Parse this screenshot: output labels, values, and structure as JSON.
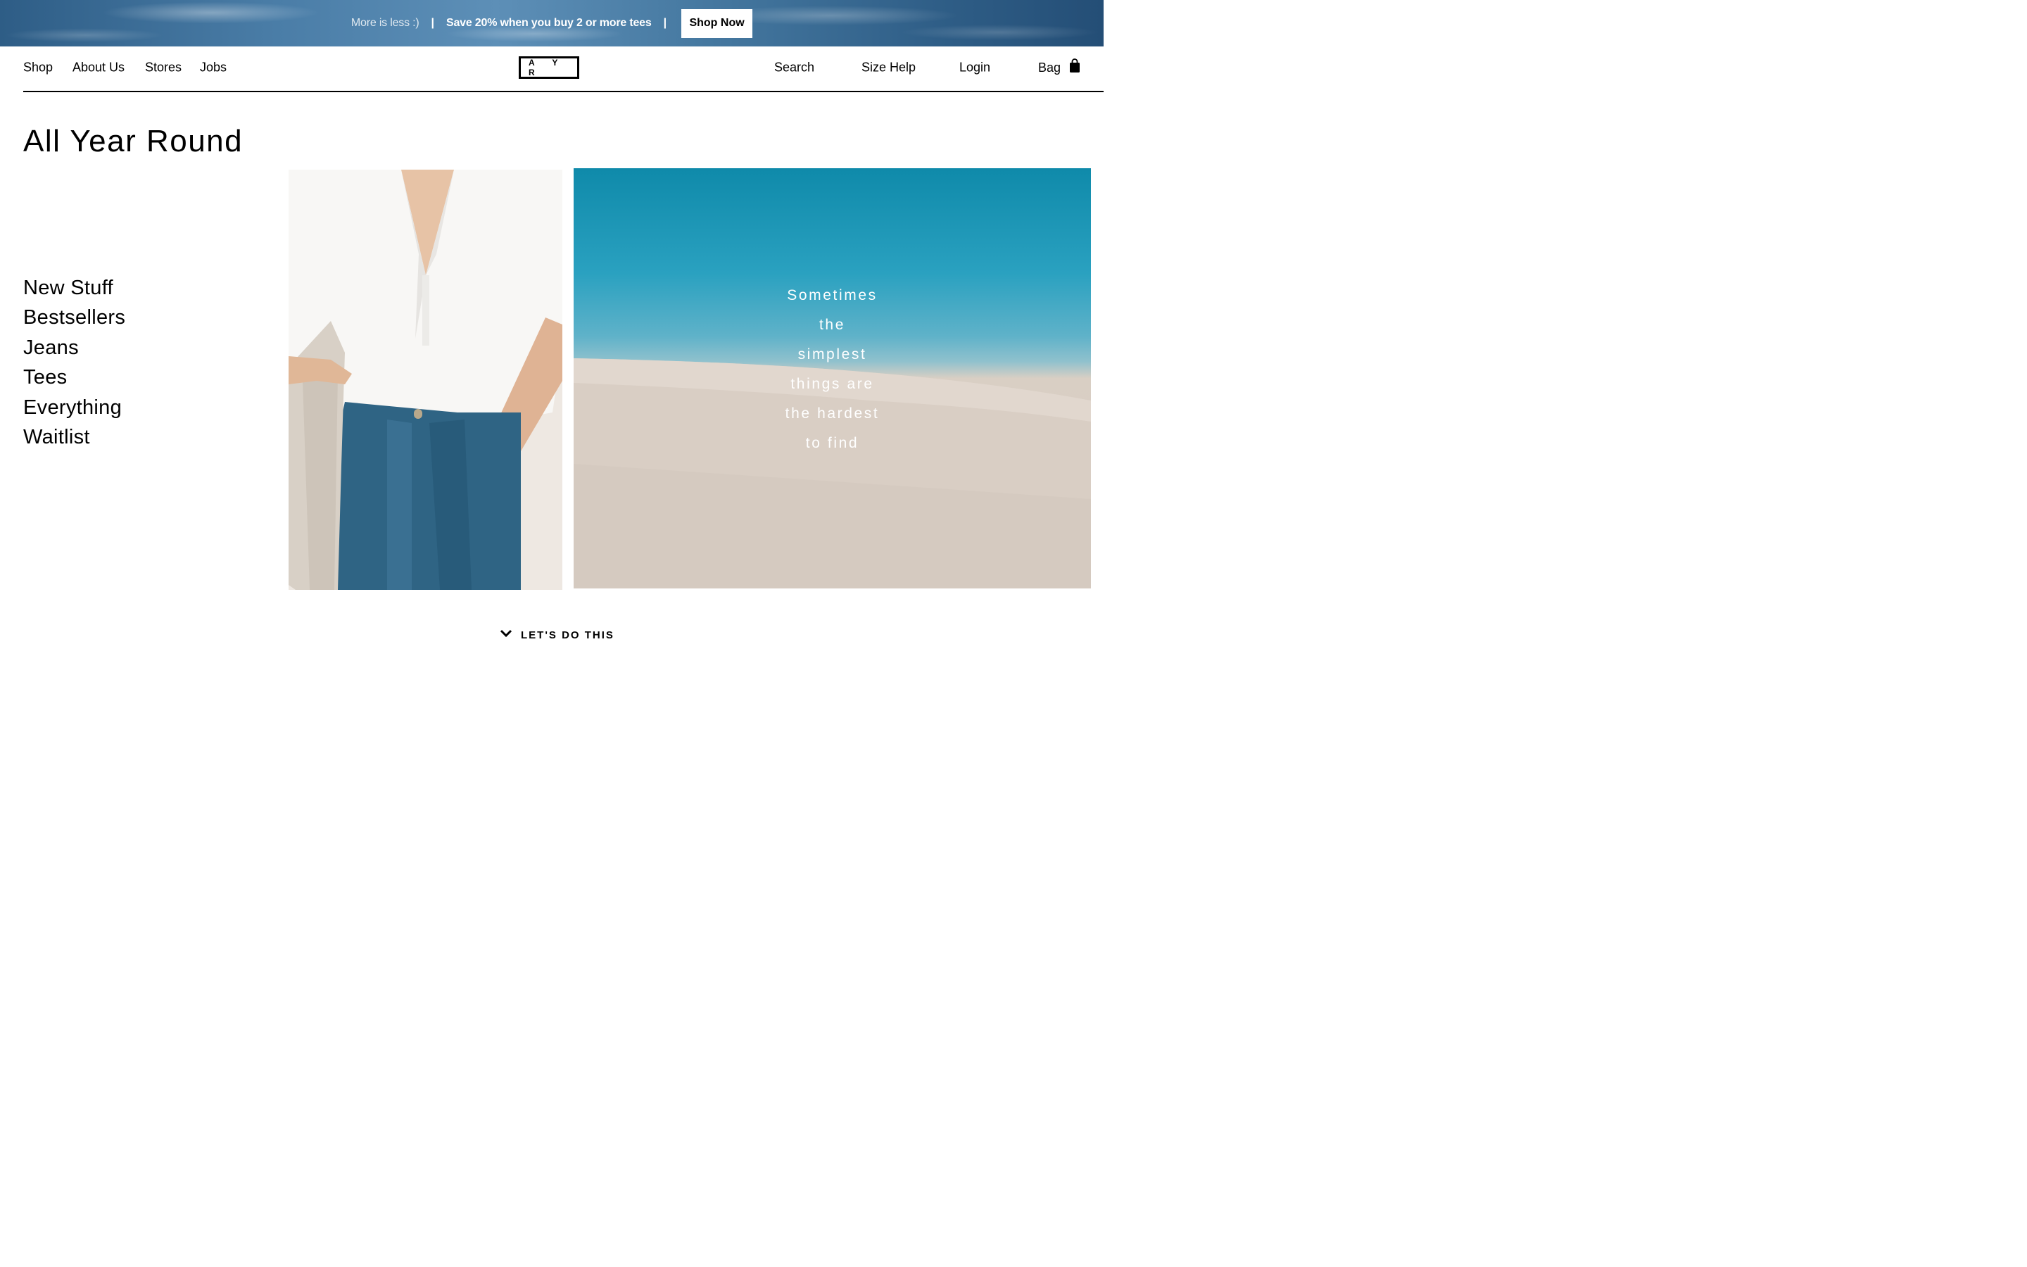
{
  "promo": {
    "tagline": "More is less :)",
    "separator": "|",
    "offer": "Save 20% when you buy 2 or more tees",
    "button_label": "Shop Now"
  },
  "nav": {
    "left_items": [
      "Shop",
      "About Us",
      "Stores",
      "Jobs"
    ],
    "logo_text": "A Y R",
    "right_items": [
      "Search",
      "Size Help",
      "Login",
      "Bag"
    ],
    "bag_icon": "bag-icon"
  },
  "page": {
    "title": "All Year Round"
  },
  "menu": {
    "items": [
      "New Stuff",
      "Bestsellers",
      "Jeans",
      "Tees",
      "Everything",
      "Waitlist"
    ]
  },
  "hero": {
    "quote_lines": [
      "Sometimes",
      "the",
      "simplest",
      "things are",
      "the hardest",
      "to find"
    ]
  },
  "cta": {
    "label": "LET'S DO THIS",
    "icon": "chevron-down-icon"
  },
  "colors": {
    "accent": "#000000",
    "banner": "#3b6d97"
  }
}
